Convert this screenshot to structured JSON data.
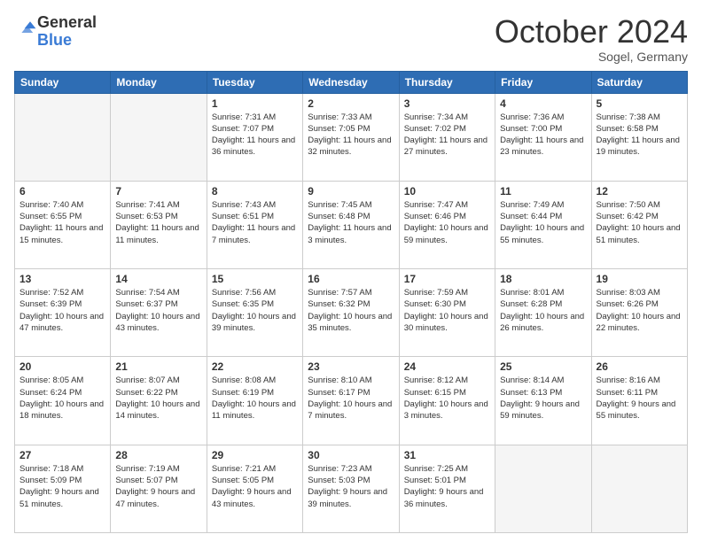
{
  "header": {
    "logo": {
      "line1": "General",
      "line2": "Blue"
    },
    "title": "October 2024",
    "location": "Sogel, Germany"
  },
  "weekdays": [
    "Sunday",
    "Monday",
    "Tuesday",
    "Wednesday",
    "Thursday",
    "Friday",
    "Saturday"
  ],
  "weeks": [
    [
      {
        "day": "",
        "info": ""
      },
      {
        "day": "",
        "info": ""
      },
      {
        "day": "1",
        "info": "Sunrise: 7:31 AM\nSunset: 7:07 PM\nDaylight: 11 hours\nand 36 minutes."
      },
      {
        "day": "2",
        "info": "Sunrise: 7:33 AM\nSunset: 7:05 PM\nDaylight: 11 hours\nand 32 minutes."
      },
      {
        "day": "3",
        "info": "Sunrise: 7:34 AM\nSunset: 7:02 PM\nDaylight: 11 hours\nand 27 minutes."
      },
      {
        "day": "4",
        "info": "Sunrise: 7:36 AM\nSunset: 7:00 PM\nDaylight: 11 hours\nand 23 minutes."
      },
      {
        "day": "5",
        "info": "Sunrise: 7:38 AM\nSunset: 6:58 PM\nDaylight: 11 hours\nand 19 minutes."
      }
    ],
    [
      {
        "day": "6",
        "info": "Sunrise: 7:40 AM\nSunset: 6:55 PM\nDaylight: 11 hours\nand 15 minutes."
      },
      {
        "day": "7",
        "info": "Sunrise: 7:41 AM\nSunset: 6:53 PM\nDaylight: 11 hours\nand 11 minutes."
      },
      {
        "day": "8",
        "info": "Sunrise: 7:43 AM\nSunset: 6:51 PM\nDaylight: 11 hours\nand 7 minutes."
      },
      {
        "day": "9",
        "info": "Sunrise: 7:45 AM\nSunset: 6:48 PM\nDaylight: 11 hours\nand 3 minutes."
      },
      {
        "day": "10",
        "info": "Sunrise: 7:47 AM\nSunset: 6:46 PM\nDaylight: 10 hours\nand 59 minutes."
      },
      {
        "day": "11",
        "info": "Sunrise: 7:49 AM\nSunset: 6:44 PM\nDaylight: 10 hours\nand 55 minutes."
      },
      {
        "day": "12",
        "info": "Sunrise: 7:50 AM\nSunset: 6:42 PM\nDaylight: 10 hours\nand 51 minutes."
      }
    ],
    [
      {
        "day": "13",
        "info": "Sunrise: 7:52 AM\nSunset: 6:39 PM\nDaylight: 10 hours\nand 47 minutes."
      },
      {
        "day": "14",
        "info": "Sunrise: 7:54 AM\nSunset: 6:37 PM\nDaylight: 10 hours\nand 43 minutes."
      },
      {
        "day": "15",
        "info": "Sunrise: 7:56 AM\nSunset: 6:35 PM\nDaylight: 10 hours\nand 39 minutes."
      },
      {
        "day": "16",
        "info": "Sunrise: 7:57 AM\nSunset: 6:32 PM\nDaylight: 10 hours\nand 35 minutes."
      },
      {
        "day": "17",
        "info": "Sunrise: 7:59 AM\nSunset: 6:30 PM\nDaylight: 10 hours\nand 30 minutes."
      },
      {
        "day": "18",
        "info": "Sunrise: 8:01 AM\nSunset: 6:28 PM\nDaylight: 10 hours\nand 26 minutes."
      },
      {
        "day": "19",
        "info": "Sunrise: 8:03 AM\nSunset: 6:26 PM\nDaylight: 10 hours\nand 22 minutes."
      }
    ],
    [
      {
        "day": "20",
        "info": "Sunrise: 8:05 AM\nSunset: 6:24 PM\nDaylight: 10 hours\nand 18 minutes."
      },
      {
        "day": "21",
        "info": "Sunrise: 8:07 AM\nSunset: 6:22 PM\nDaylight: 10 hours\nand 14 minutes."
      },
      {
        "day": "22",
        "info": "Sunrise: 8:08 AM\nSunset: 6:19 PM\nDaylight: 10 hours\nand 11 minutes."
      },
      {
        "day": "23",
        "info": "Sunrise: 8:10 AM\nSunset: 6:17 PM\nDaylight: 10 hours\nand 7 minutes."
      },
      {
        "day": "24",
        "info": "Sunrise: 8:12 AM\nSunset: 6:15 PM\nDaylight: 10 hours\nand 3 minutes."
      },
      {
        "day": "25",
        "info": "Sunrise: 8:14 AM\nSunset: 6:13 PM\nDaylight: 9 hours\nand 59 minutes."
      },
      {
        "day": "26",
        "info": "Sunrise: 8:16 AM\nSunset: 6:11 PM\nDaylight: 9 hours\nand 55 minutes."
      }
    ],
    [
      {
        "day": "27",
        "info": "Sunrise: 7:18 AM\nSunset: 5:09 PM\nDaylight: 9 hours\nand 51 minutes."
      },
      {
        "day": "28",
        "info": "Sunrise: 7:19 AM\nSunset: 5:07 PM\nDaylight: 9 hours\nand 47 minutes."
      },
      {
        "day": "29",
        "info": "Sunrise: 7:21 AM\nSunset: 5:05 PM\nDaylight: 9 hours\nand 43 minutes."
      },
      {
        "day": "30",
        "info": "Sunrise: 7:23 AM\nSunset: 5:03 PM\nDaylight: 9 hours\nand 39 minutes."
      },
      {
        "day": "31",
        "info": "Sunrise: 7:25 AM\nSunset: 5:01 PM\nDaylight: 9 hours\nand 36 minutes."
      },
      {
        "day": "",
        "info": ""
      },
      {
        "day": "",
        "info": ""
      }
    ]
  ]
}
